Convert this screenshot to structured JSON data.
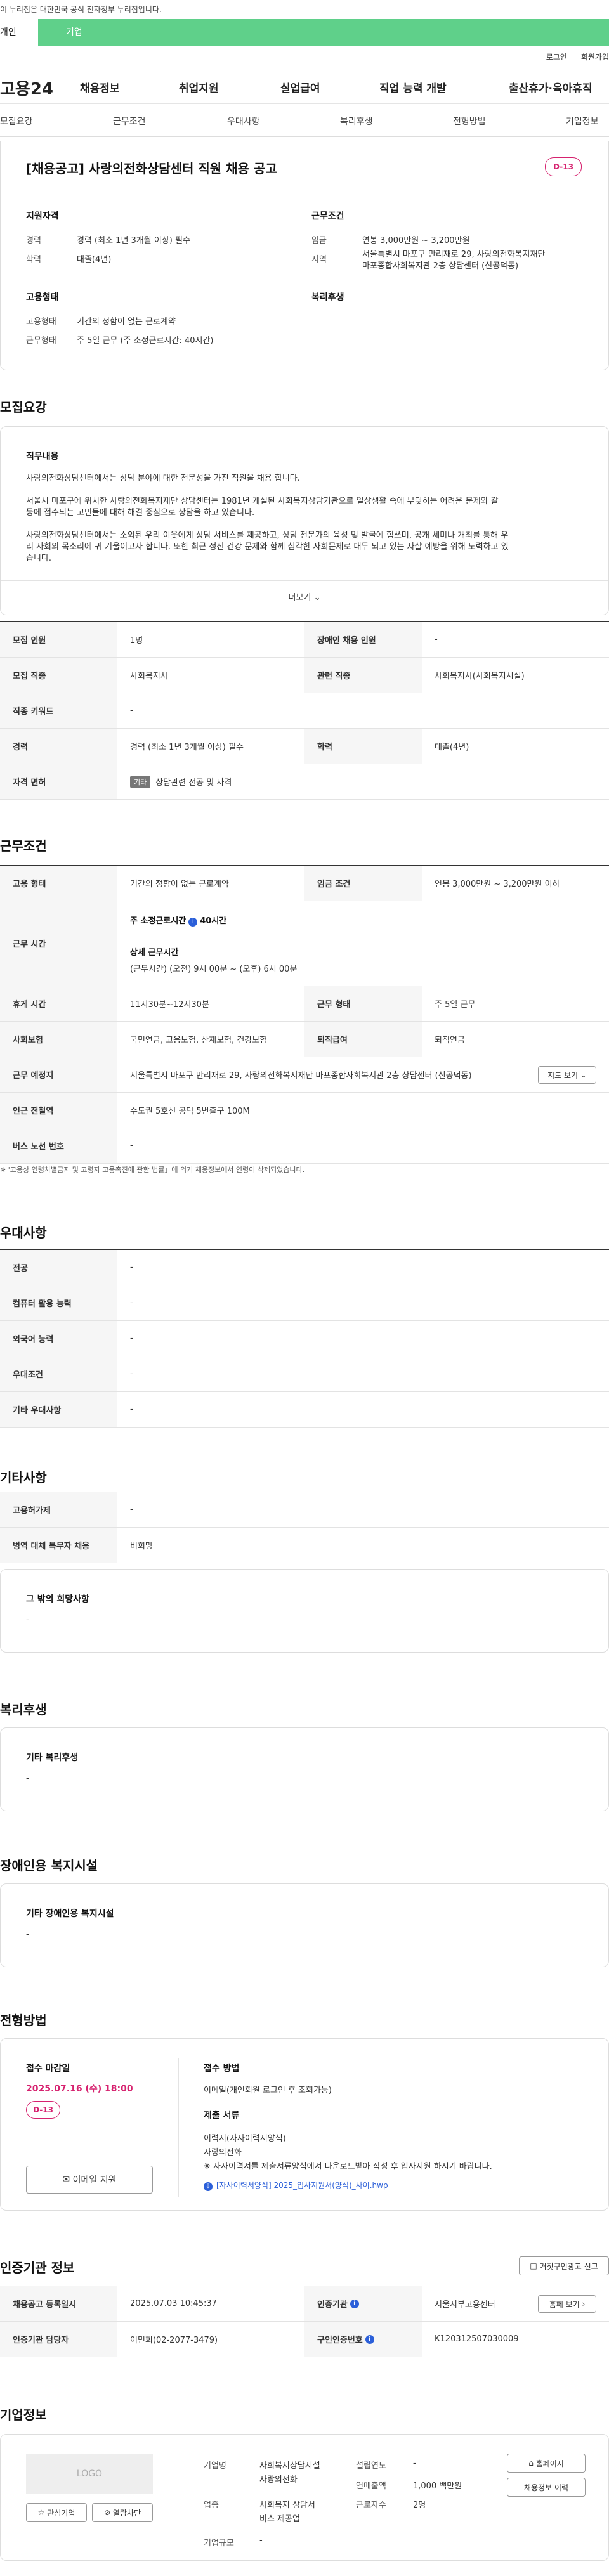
{
  "gov_bar": "이 누리집은 대한민국 공식 전자정부 누리집입니다.",
  "top_tabs": [
    "개인",
    "기업"
  ],
  "util": [
    "로그인",
    "회원가입"
  ],
  "logo": "고용24",
  "gnb": [
    "채용정보",
    "취업지원",
    "실업급여",
    "직업 능력 개발",
    "출산휴가·육아휴직"
  ],
  "anchor": [
    "모집요강",
    "근무조건",
    "우대사항",
    "복리후생",
    "전형방법",
    "기업정보"
  ],
  "summary": {
    "title": "[채용공고] 사랑의전화상담센터 직원 채용 공고",
    "dday": "D-13",
    "qual_head": "지원자격",
    "career_l": "경력",
    "career_v": "경력 (최소 1년 3개월 이상) 필수",
    "edu_l": "학력",
    "edu_v": "대졸(4년)",
    "emp_head": "고용형태",
    "emptype_l": "고용형태",
    "emptype_v": "기간의 정함이 없는 근로계약",
    "worktype_l": "근무형태",
    "worktype_v": "주 5일 근무 (주 소정근로시간: 40시간)",
    "cond_head": "근무조건",
    "wage_l": "임금",
    "wage_v": "연봉 3,000만원 ~ 3,200만원",
    "region_l": "지역",
    "region_v1": "서울특별시 마포구 만리재로 29, 사랑의전화복지재단",
    "region_v2": "마포종합사회복지관 2층 상담센터 (신공덕동)",
    "welfare_head": "복리후생"
  },
  "recruit": {
    "heading": "모집요강",
    "duty_head": "직무내용",
    "p1": "사랑의전화상담센터에서는 상담 분야에 대한 전문성을 가진 직원을 채용 합니다.",
    "p2a": "서울시 마포구에 위치한 사랑의전화복지재단 상담센터는 1981년 개설된 사회복지상담기관으로 일상생활 속에 부딪히는 어려운 문제와 갈",
    "p2b": "등에 접수되는 고민들에 대해 해결 중심으로 상담을 하고 있습니다.",
    "p3a": "사랑의전화상담센터에서는 소외된 우리 이웃에게 상담 서비스를 제공하고, 상담 전문가의 육성 및 발굴에 힘쓰며, 공개 세미나 개최를 통해 우",
    "p3b": "리 사회의 목소리에 귀 기울이고자 합니다. 또한 최근 정신 건강 문제와 함께 심각한 사회문제로 대두 되고 있는 자살 예방을 위해 노력하고 있",
    "p3c": "습니다.",
    "more": "더보기",
    "rows": [
      {
        "th1": "모집 인원",
        "td1": "1명",
        "th2": "장애인 채용 인원",
        "td2": "-"
      },
      {
        "th1": "모집 직종",
        "td1": "사회복지사",
        "th2": "관련 직종",
        "td2": "사회복지사(사회복지시설)"
      },
      {
        "th1": "직종 키워드",
        "td1": "-"
      },
      {
        "th1": "경력",
        "td1": "경력 (최소 1년 3개월 이상) 필수",
        "th2": "학력",
        "td2": "대졸(4년)"
      },
      {
        "th1": "자격 면허",
        "badge": "기타",
        "td1": "상담관련 전공 및 자격"
      }
    ]
  },
  "cond": {
    "heading": "근무조건",
    "emp_th": "고용 형태",
    "emp_td": "기간의 정함이 없는 근로계약",
    "wage_th": "임금 조건",
    "wage_td": "연봉 3,000만원 ~ 3,200만원 이하",
    "time_th": "근무 시간",
    "time1": "주 소정근로시간",
    "time1v": "40시간",
    "time2": "상세 근무시간",
    "time3": "(근무시간) (오전) 9시 00분 ~ (오후) 6시 00분",
    "rest_th": "휴게 시간",
    "rest_td": "11시30분~12시30분",
    "form_th": "근무 형태",
    "form_td": "주 5일 근무",
    "ins_th": "사회보험",
    "ins_td": "국민연금, 고용보험, 산재보험, 건강보험",
    "ret_th": "퇴직급여",
    "ret_td": "퇴직연금",
    "addr_th": "근무 예정지",
    "addr_td": "서울특별시 마포구 만리재로 29, 사랑의전화복지재단 마포종합사회복지관 2층 상담센터 (신공덕동)",
    "map": "지도 보기",
    "sub_th": "인근 전철역",
    "sub_td": "수도권 5호선 공덕 5번출구 100M",
    "bus_th": "버스 노선 번호",
    "bus_td": "-",
    "note": "※ '고용상 연령차별금지 및 고령자 고용촉진에 관한 법률」에 의거 채용정보에서 연령이 삭제되었습니다."
  },
  "pref": {
    "heading": "우대사항",
    "rows": [
      [
        "전공",
        "-"
      ],
      [
        "컴퓨터 활용 능력",
        "-"
      ],
      [
        "외국어 능력",
        "-"
      ],
      [
        "우대조건",
        "-"
      ],
      [
        "기타 우대사항",
        "-"
      ]
    ]
  },
  "etc": {
    "heading": "기타사항",
    "rows": [
      [
        "고용허가제",
        "-"
      ],
      [
        "병역 대체 복무자 채용",
        "비희망"
      ]
    ],
    "box_head": "그 밖의 희망사항",
    "box_val": "-"
  },
  "welfare": {
    "heading": "복리후생",
    "box_head": "기타 복리후생",
    "box_val": "-"
  },
  "disab": {
    "heading": "장애인용 복지시설",
    "box_head": "기타 장애인용 복지시설",
    "box_val": "-"
  },
  "apply": {
    "heading": "전형방법",
    "deadline_head": "접수 마감일",
    "deadline": "2025.07.16 (수) 18:00",
    "dday": "D-13",
    "email_btn": "이메일 지원",
    "method_head": "접수 방법",
    "method_v": "이메일(개인회원 로그인 후 조회가능)",
    "docs_head": "제출 서류",
    "docs1": "이력서(자사이력서양식)",
    "docs2": "사랑의전화",
    "docs3": "※ 자사이력서를 제출서류양식에서 다운로드받아 작성 후 입사지원 하시기 바랍니다.",
    "file": "[자사이력서양식] 2025_입사지원서(양식)_사이.hwp"
  },
  "cert": {
    "heading": "인증기관 정보",
    "report": "거짓구인광고 신고",
    "reg_th": "채용공고 등록일시",
    "reg_td": "2025.07.03 10:45:37",
    "org_th": "인증기관",
    "org_td": "서울서부고용센터",
    "home": "홈페 보기",
    "mgr_th": "인증기관 담당자",
    "mgr_td": "이민희(02-2077-3479)",
    "num_th": "구인인증번호",
    "num_td": "K120312507030009"
  },
  "company": {
    "heading": "기업정보",
    "logo": "LOGO",
    "fav": "관심기업",
    "block": "열람차단",
    "name_l": "기업명",
    "name_v1": "사회복지상담시설",
    "name_v2": "사랑의전화",
    "biz_l": "업종",
    "biz_v1": "사회복지 상담서",
    "biz_v2": "비스 제공업",
    "size_l": "기업규모",
    "size_v": "-",
    "est_l": "설립연도",
    "est_v": "-",
    "sales_l": "연매출액",
    "sales_v": "1,000 백만원",
    "emp_l": "근로자수",
    "emp_v": "2명",
    "homepage": "홈페이지",
    "jobs": "채용정보 이력"
  }
}
